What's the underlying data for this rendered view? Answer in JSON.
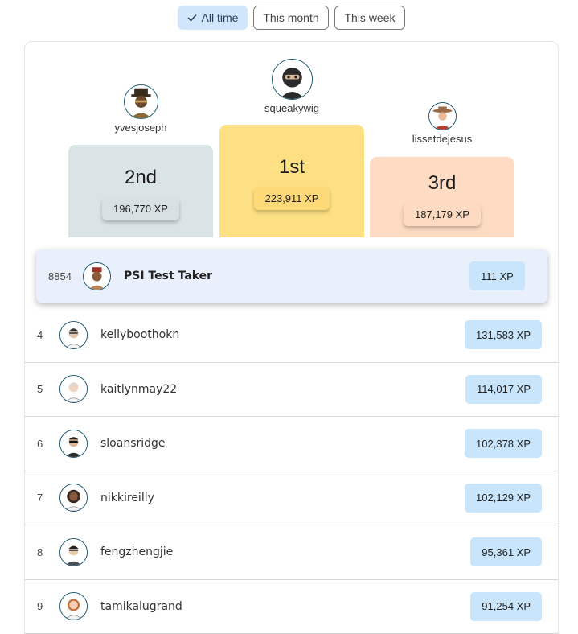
{
  "filters": [
    {
      "label": "All time",
      "active": true
    },
    {
      "label": "This month",
      "active": false
    },
    {
      "label": "This week",
      "active": false
    }
  ],
  "podium": {
    "first": {
      "name": "squeakywig",
      "rank_label": "1st",
      "xp": "223,911 XP",
      "color": "#fde083",
      "pill_color": "#fdd978"
    },
    "second": {
      "name": "yvesjoseph",
      "rank_label": "2nd",
      "xp": "196,770 XP",
      "color": "#dae3e5",
      "pill_color": "#d7e0e3"
    },
    "third": {
      "name": "lissetdejesus",
      "rank_label": "3rd",
      "xp": "187,179 XP",
      "color": "#fedcc3",
      "pill_color": "#fddbc2"
    }
  },
  "current_user": {
    "rank": "8854",
    "name": "PSI Test Taker",
    "xp": "111 XP"
  },
  "rows": [
    {
      "rank": "4",
      "name": "kellyboothokn",
      "xp": "131,583 XP"
    },
    {
      "rank": "5",
      "name": "kaitlynmay22",
      "xp": "114,017 XP"
    },
    {
      "rank": "6",
      "name": "sloansridge",
      "xp": "102,378 XP"
    },
    {
      "rank": "7",
      "name": "nikkireilly",
      "xp": "102,129 XP"
    },
    {
      "rank": "8",
      "name": "fengzhengjie",
      "xp": "95,361 XP"
    },
    {
      "rank": "9",
      "name": "tamikalugrand",
      "xp": "91,254 XP"
    }
  ],
  "colors": {
    "accent": "#cfe6fb",
    "xp_badge": "#c9e5fb",
    "avatar_ring": "#1d5a73"
  }
}
